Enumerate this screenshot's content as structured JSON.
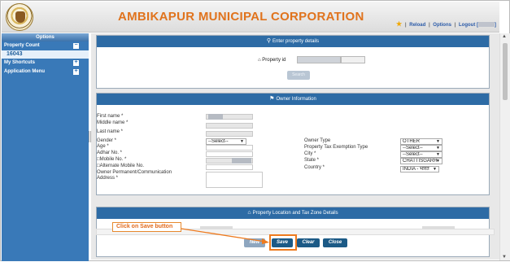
{
  "header": {
    "title": "AMBIKAPUR MUNICIPAL CORPORATION",
    "links": {
      "reload": "Reload",
      "options": "Options",
      "logout": "Logout ["
    },
    "separator": "|",
    "logout_end": "]"
  },
  "sidebar": {
    "options_title": "Options",
    "property_count_label": "Property Count",
    "property_count_value": "16043",
    "shortcuts_label": "My Shortcuts",
    "app_menu_label": "Application Menu",
    "collapse_symbol": "−",
    "expand_symbol": "+"
  },
  "panels": {
    "enter_property": {
      "title": "Enter property details",
      "property_id_label": "Property id",
      "search_button": "Search"
    },
    "owner_info": {
      "title": "Owner Information",
      "labels": {
        "first_name": "First name *",
        "middle_name": "Middle name *",
        "last_name": "Last name *",
        "gender": "Gender *",
        "age": "Age *",
        "adhar": "Adhar No. *",
        "mobile": "□Mobile No. *",
        "alt_mobile": "□Alternate Mobile No.",
        "address_1": "Owner Permanent/Communication",
        "address_2": "Address *",
        "owner_type": "Owner Type",
        "exemption": "Property Tax Exemption Type",
        "city": "City *",
        "state": "State *",
        "country": "Country *"
      },
      "values": {
        "gender": "--Select--",
        "owner_type": "OTHER",
        "exemption": "--Select--",
        "city": "--Select--",
        "state": "CHATTISGARH",
        "country": "INDIA - भारत"
      }
    },
    "location": {
      "title": "Property Location and Tax Zone Details"
    }
  },
  "buttons": {
    "new": "New",
    "save": "Save",
    "clear": "Clear",
    "close": "Close"
  },
  "callout": {
    "text": "Click on Save button"
  },
  "colors": {
    "header_title": "#e0731d",
    "sidebar": "#3979b8",
    "panel_head": "#2d6ba5",
    "button": "#1c5a86",
    "highlight": "#ee7a1e"
  }
}
